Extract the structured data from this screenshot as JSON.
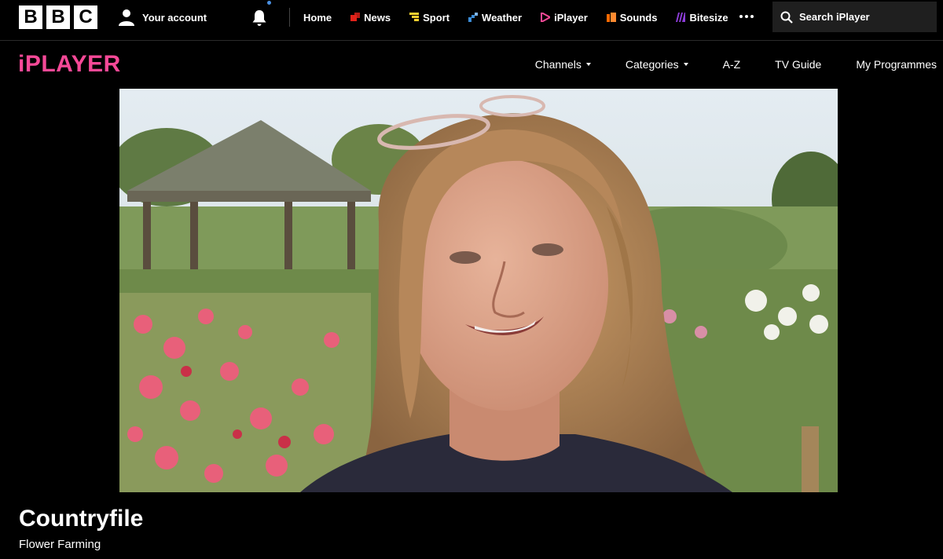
{
  "global_nav": {
    "logo": [
      "B",
      "B",
      "C"
    ],
    "account_label": "Your account",
    "items": [
      {
        "label": "Home",
        "icon": "",
        "color": ""
      },
      {
        "label": "News",
        "icon": "news-icon",
        "color": "#e2231a"
      },
      {
        "label": "Sport",
        "icon": "sport-icon",
        "color": "#ffd230"
      },
      {
        "label": "Weather",
        "icon": "weather-icon",
        "color": "#3c8dd8"
      },
      {
        "label": "iPlayer",
        "icon": "iplayer-icon",
        "color": "#f54997"
      },
      {
        "label": "Sounds",
        "icon": "sounds-icon",
        "color": "#ff6a00"
      },
      {
        "label": "Bitesize",
        "icon": "bitesize-icon",
        "color": "#8c3dd8"
      }
    ],
    "search_placeholder": "Search iPlayer"
  },
  "iplayer_nav": {
    "logo": "iPLAYER",
    "items": [
      {
        "label": "Channels",
        "dropdown": true
      },
      {
        "label": "Categories",
        "dropdown": true
      },
      {
        "label": "A-Z",
        "dropdown": false
      },
      {
        "label": "TV Guide",
        "dropdown": false
      },
      {
        "label": "My Programmes",
        "dropdown": false
      }
    ]
  },
  "programme": {
    "title": "Countryfile",
    "episode": "Flower Farming"
  },
  "colors": {
    "iplayer_pink": "#f54997",
    "background": "#000000"
  }
}
